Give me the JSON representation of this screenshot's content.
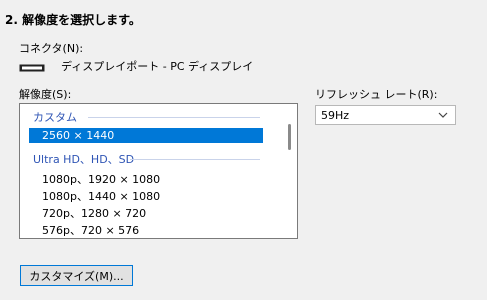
{
  "step_title": "2. 解像度を選択します。",
  "connector": {
    "label": "コネクタ(N):",
    "value": "ディスプレイポート - PC ディスプレイ",
    "icon": "monitor-connector-icon"
  },
  "resolution": {
    "label": "解像度(S):",
    "groups": [
      {
        "header": "カスタム",
        "items": [
          "2560 × 1440"
        ]
      },
      {
        "header": "Ultra HD、HD、SD",
        "items": [
          "1080p、1920 × 1080",
          "1080p、1440 × 1080",
          "720p、1280 × 720",
          "576p、720 × 576"
        ]
      }
    ],
    "selected": "2560 × 1440"
  },
  "refresh_rate": {
    "label": "リフレッシュ レート(R):",
    "value": "59Hz",
    "icon": "chevron-down-icon"
  },
  "customize_button": "カスタマイズ(M)..."
}
